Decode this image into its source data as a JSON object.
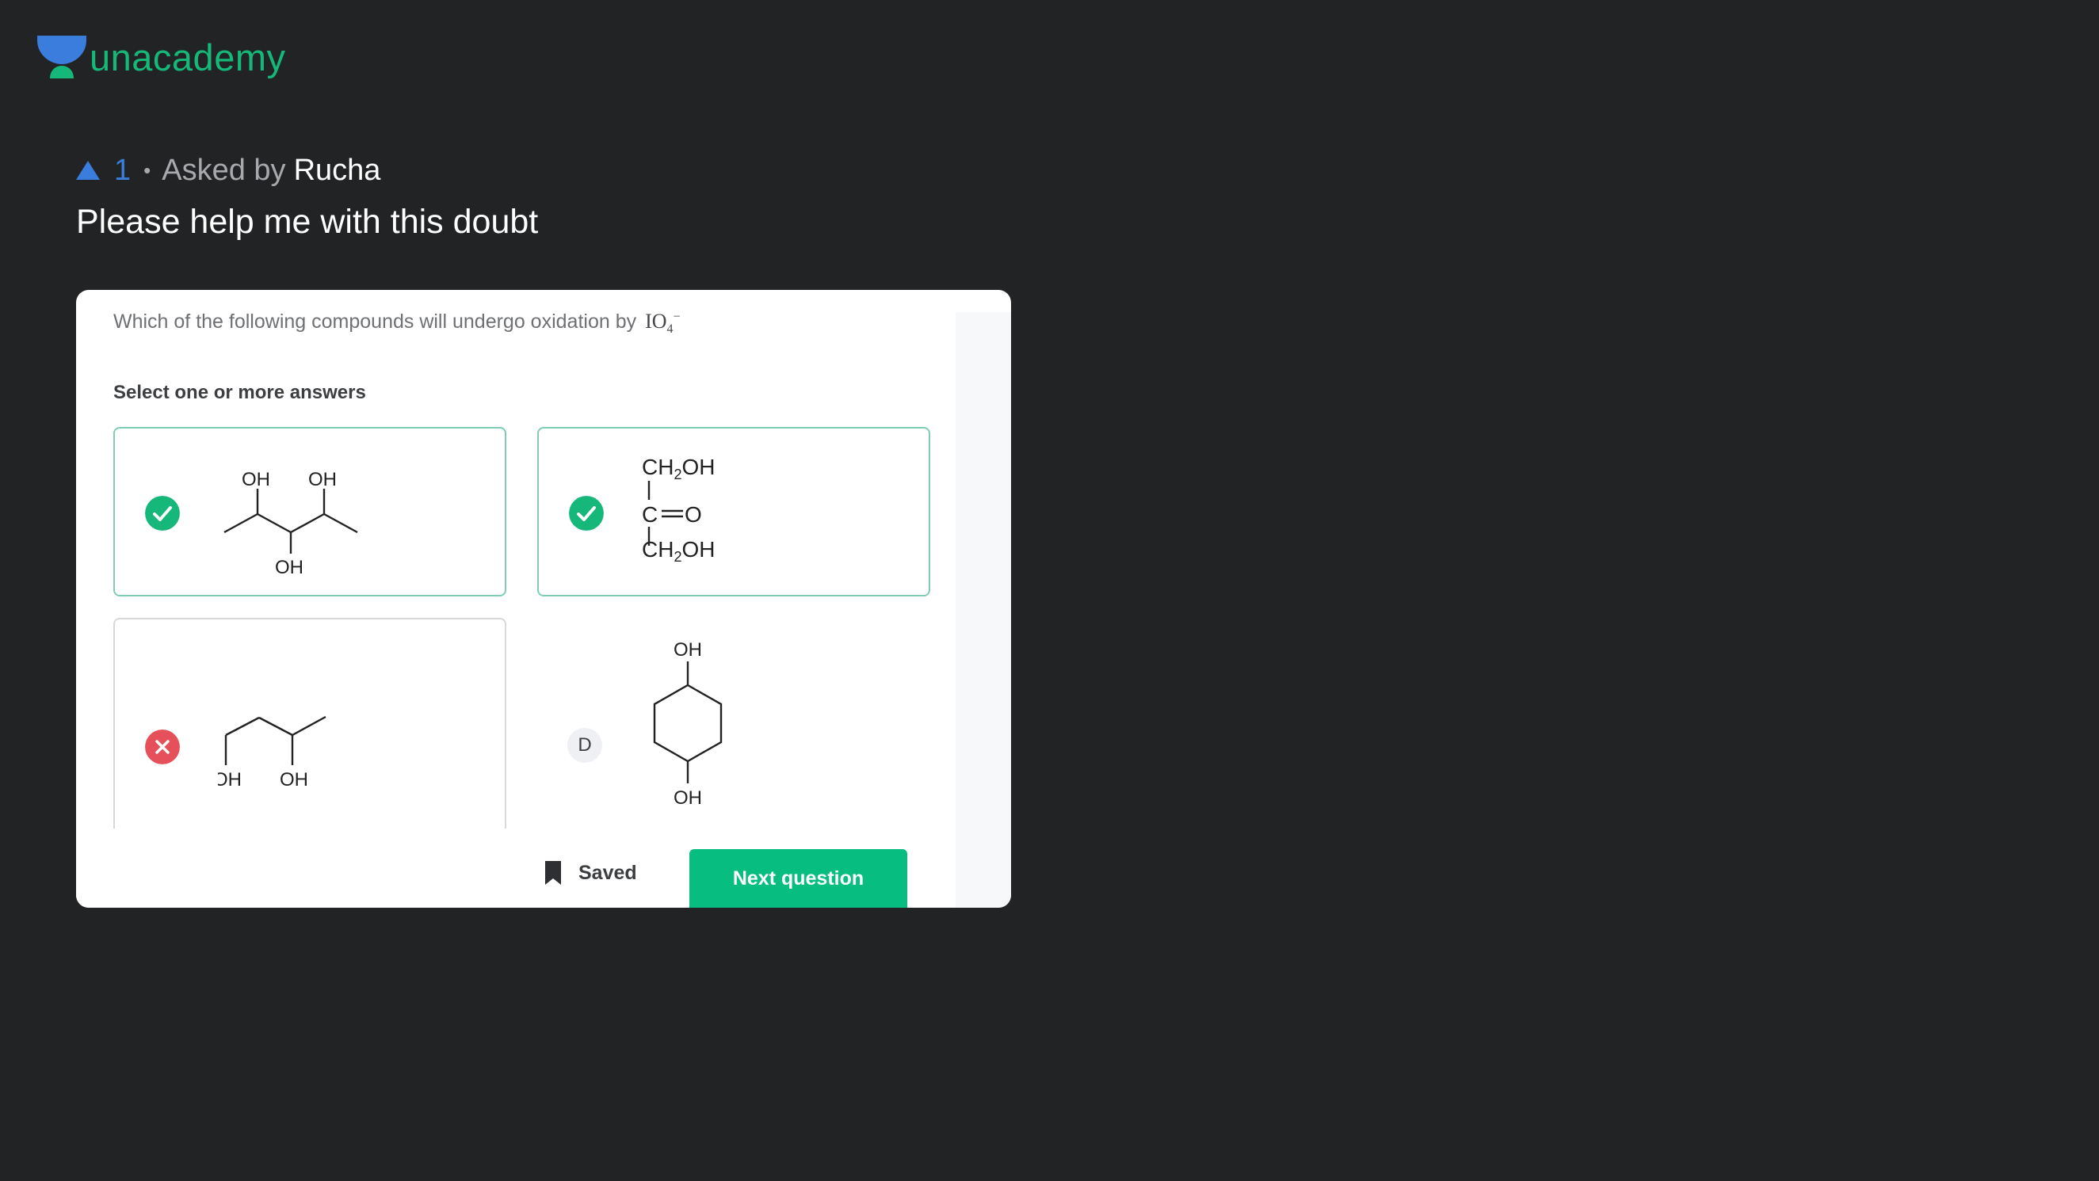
{
  "brand": {
    "name": "unacademy",
    "color": "#16b879"
  },
  "doubt": {
    "upvotes": "1",
    "separator": "•",
    "asked_by_label": "Asked by",
    "asker": "Rucha",
    "title": "Please help me with this doubt"
  },
  "question": {
    "text": "Which of the following compounds will undergo oxidation by",
    "formula_main": "IO",
    "formula_sub": "4",
    "formula_sup": "−",
    "select_label": "Select one or more answers",
    "options": [
      {
        "status": "correct",
        "icon": "check-circle-icon",
        "labels": [
          "OH",
          "OH",
          "OH"
        ]
      },
      {
        "status": "correct",
        "icon": "check-circle-icon",
        "labels": [
          "CH",
          "2",
          "OH",
          "C",
          "O",
          "CH",
          "2",
          "OH"
        ]
      },
      {
        "status": "wrong",
        "icon": "cross-circle-icon",
        "labels": [
          "OH",
          "OH"
        ]
      },
      {
        "status": "unanswered",
        "letter": "D",
        "labels": [
          "OH",
          "OH"
        ]
      }
    ]
  },
  "actions": {
    "saved_label": "Saved",
    "next_label": "Next question"
  },
  "colors": {
    "background": "#222325",
    "upvote": "#3b7ddd",
    "correct": "#16b879",
    "wrong": "#e6505a",
    "next_button": "#08bd80"
  }
}
